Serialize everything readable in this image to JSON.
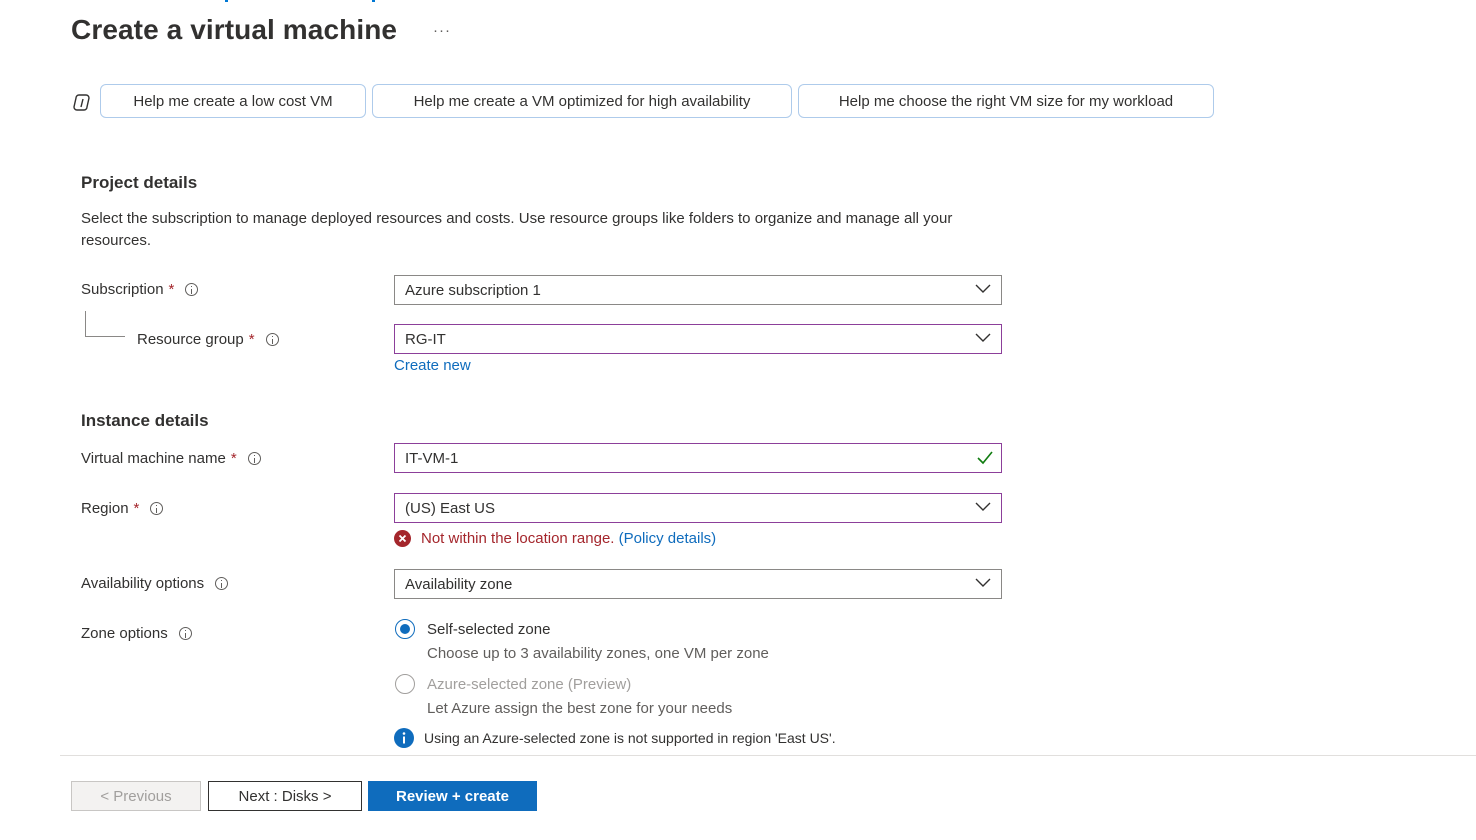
{
  "header": {
    "title": "Create a virtual machine",
    "more": "···"
  },
  "copilot": {
    "suggestions": [
      "Help me create a low cost VM",
      "Help me create a VM optimized for high availability",
      "Help me choose the right VM size for my workload"
    ]
  },
  "project": {
    "heading": "Project details",
    "description": "Select the subscription to manage deployed resources and costs. Use resource groups like folders to organize and manage all your resources.",
    "subscription": {
      "label": "Subscription",
      "required": "*",
      "value": "Azure subscription 1"
    },
    "resource_group": {
      "label": "Resource group",
      "required": "*",
      "value": "RG-IT",
      "create_new": "Create new"
    }
  },
  "instance": {
    "heading": "Instance details",
    "vm_name": {
      "label": "Virtual machine name",
      "required": "*",
      "value": "IT-VM-1"
    },
    "region": {
      "label": "Region",
      "required": "*",
      "value": "(US) East US",
      "error": "Not within the location range.",
      "error_link": "(Policy details)"
    },
    "availability": {
      "label": "Availability options",
      "value": "Availability zone"
    },
    "zone": {
      "label": "Zone options",
      "options": [
        {
          "label": "Self-selected zone",
          "sub": "Choose up to 3 availability zones, one VM per zone",
          "selected": true,
          "disabled": false
        },
        {
          "label": "Azure-selected zone (Preview)",
          "sub": "Let Azure assign the best zone for your needs",
          "selected": false,
          "disabled": true
        }
      ],
      "note": "Using an Azure-selected zone is not supported in region 'East US'."
    }
  },
  "footer": {
    "previous": "< Previous",
    "next": "Next : Disks >",
    "review": "Review + create"
  },
  "colors": {
    "accent": "#0f6cbd",
    "error": "#a4262c",
    "valid": "#107c10",
    "field_focus_border": "#8c3f9a"
  }
}
